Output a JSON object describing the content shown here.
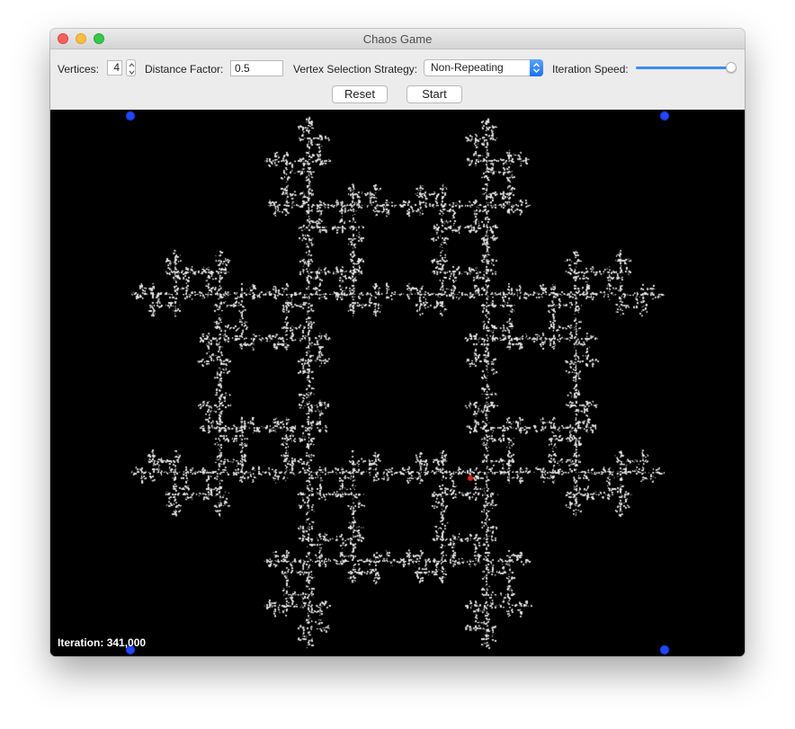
{
  "window": {
    "title": "Chaos Game"
  },
  "toolbar": {
    "vertices_label": "Vertices:",
    "vertices_value": "4",
    "distance_label": "Distance Factor:",
    "distance_value": "0.5",
    "strategy_label": "Vertex Selection Strategy:",
    "strategy_value": "Non-Repeating",
    "speed_label": "Iteration Speed:",
    "speed_level": 1.0,
    "reset_label": "Reset",
    "start_label": "Start"
  },
  "canvas": {
    "iteration_label": "Iteration:",
    "iteration_value": "341,000",
    "vertex_color": "#1f47ff",
    "current_point_color": "#e0201c",
    "point_color": "#e8e8e8",
    "background": "#000000"
  },
  "icons": [
    "close-icon",
    "minimize-icon",
    "zoom-icon",
    "stepper-arrows-icon",
    "popup-arrows-icon"
  ]
}
